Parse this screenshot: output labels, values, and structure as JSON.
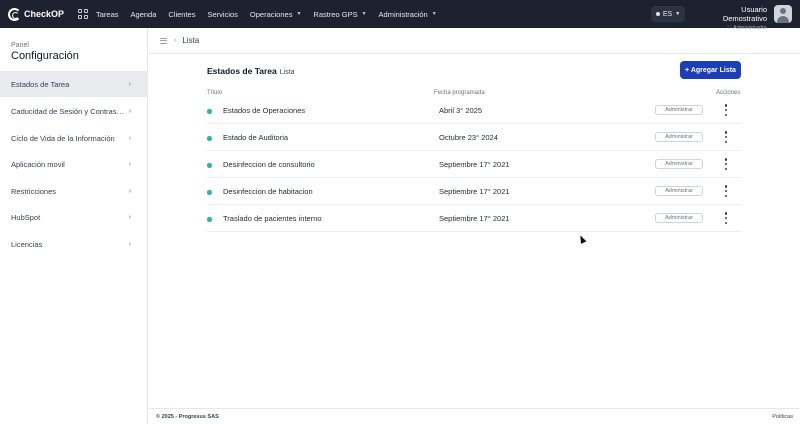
{
  "app": {
    "logo_text": "CheckOP"
  },
  "nav": {
    "items": [
      {
        "label": "Tareas",
        "has_caret": false
      },
      {
        "label": "Agenda",
        "has_caret": false
      },
      {
        "label": "Clientes",
        "has_caret": false
      },
      {
        "label": "Servicios",
        "has_caret": false
      },
      {
        "label": "Operaciones",
        "has_caret": true
      },
      {
        "label": "Rastreo GPS",
        "has_caret": true
      },
      {
        "label": "Administración",
        "has_caret": true
      }
    ],
    "caret_glyph": "▼"
  },
  "language": {
    "label": "ES"
  },
  "user": {
    "name": "Usuario Demostrativo",
    "role": "♡ Administrador"
  },
  "sidebar": {
    "subtitle": "Panel",
    "title": "Configuración",
    "chevron": "›",
    "items": [
      {
        "label": "Estados de Tarea",
        "active": true
      },
      {
        "label": "Caducidad de Sesión y Contraseña",
        "active": false
      },
      {
        "label": "Ciclo de Vida de la Información",
        "active": false
      },
      {
        "label": "Aplicación movil",
        "active": false
      },
      {
        "label": "Restricciones",
        "active": false
      },
      {
        "label": "HubSpot",
        "active": false
      },
      {
        "label": "Licencias",
        "active": false
      }
    ]
  },
  "breadcrumb": {
    "separator": "›",
    "current": "Lista"
  },
  "main": {
    "title": "Estados de Tarea",
    "subtitle": "Lista",
    "add_button": "+ Agregar Lista",
    "columns": {
      "title": "Título",
      "date": "Fecha programada",
      "actions": "Acciones"
    },
    "rows": [
      {
        "title": "Estados de Operaciones",
        "date": "Abril 3° 2025",
        "action": "Administrar"
      },
      {
        "title": "Estado de Auditoria",
        "date": "Octubre 23° 2024",
        "action": "Administrar"
      },
      {
        "title": "Desinfeccion de consultorio",
        "date": "Septiembre 17° 2021",
        "action": "Administrar"
      },
      {
        "title": "Desinfeccion de habitacion",
        "date": "Septiembre 17° 2021",
        "action": "Administrar"
      },
      {
        "title": "Traslado de pacientes interno",
        "date": "Septiembre 17° 2021",
        "action": "Administrar"
      }
    ]
  },
  "footer": {
    "copyright": "© 2025 - Progresus SAS",
    "policies": "Políticas"
  },
  "colors": {
    "topbar": "#1e2230",
    "primary_button": "#1d3fb5",
    "status_dot": "#2fb5a8",
    "active_sidebar": "#e9eaee"
  }
}
